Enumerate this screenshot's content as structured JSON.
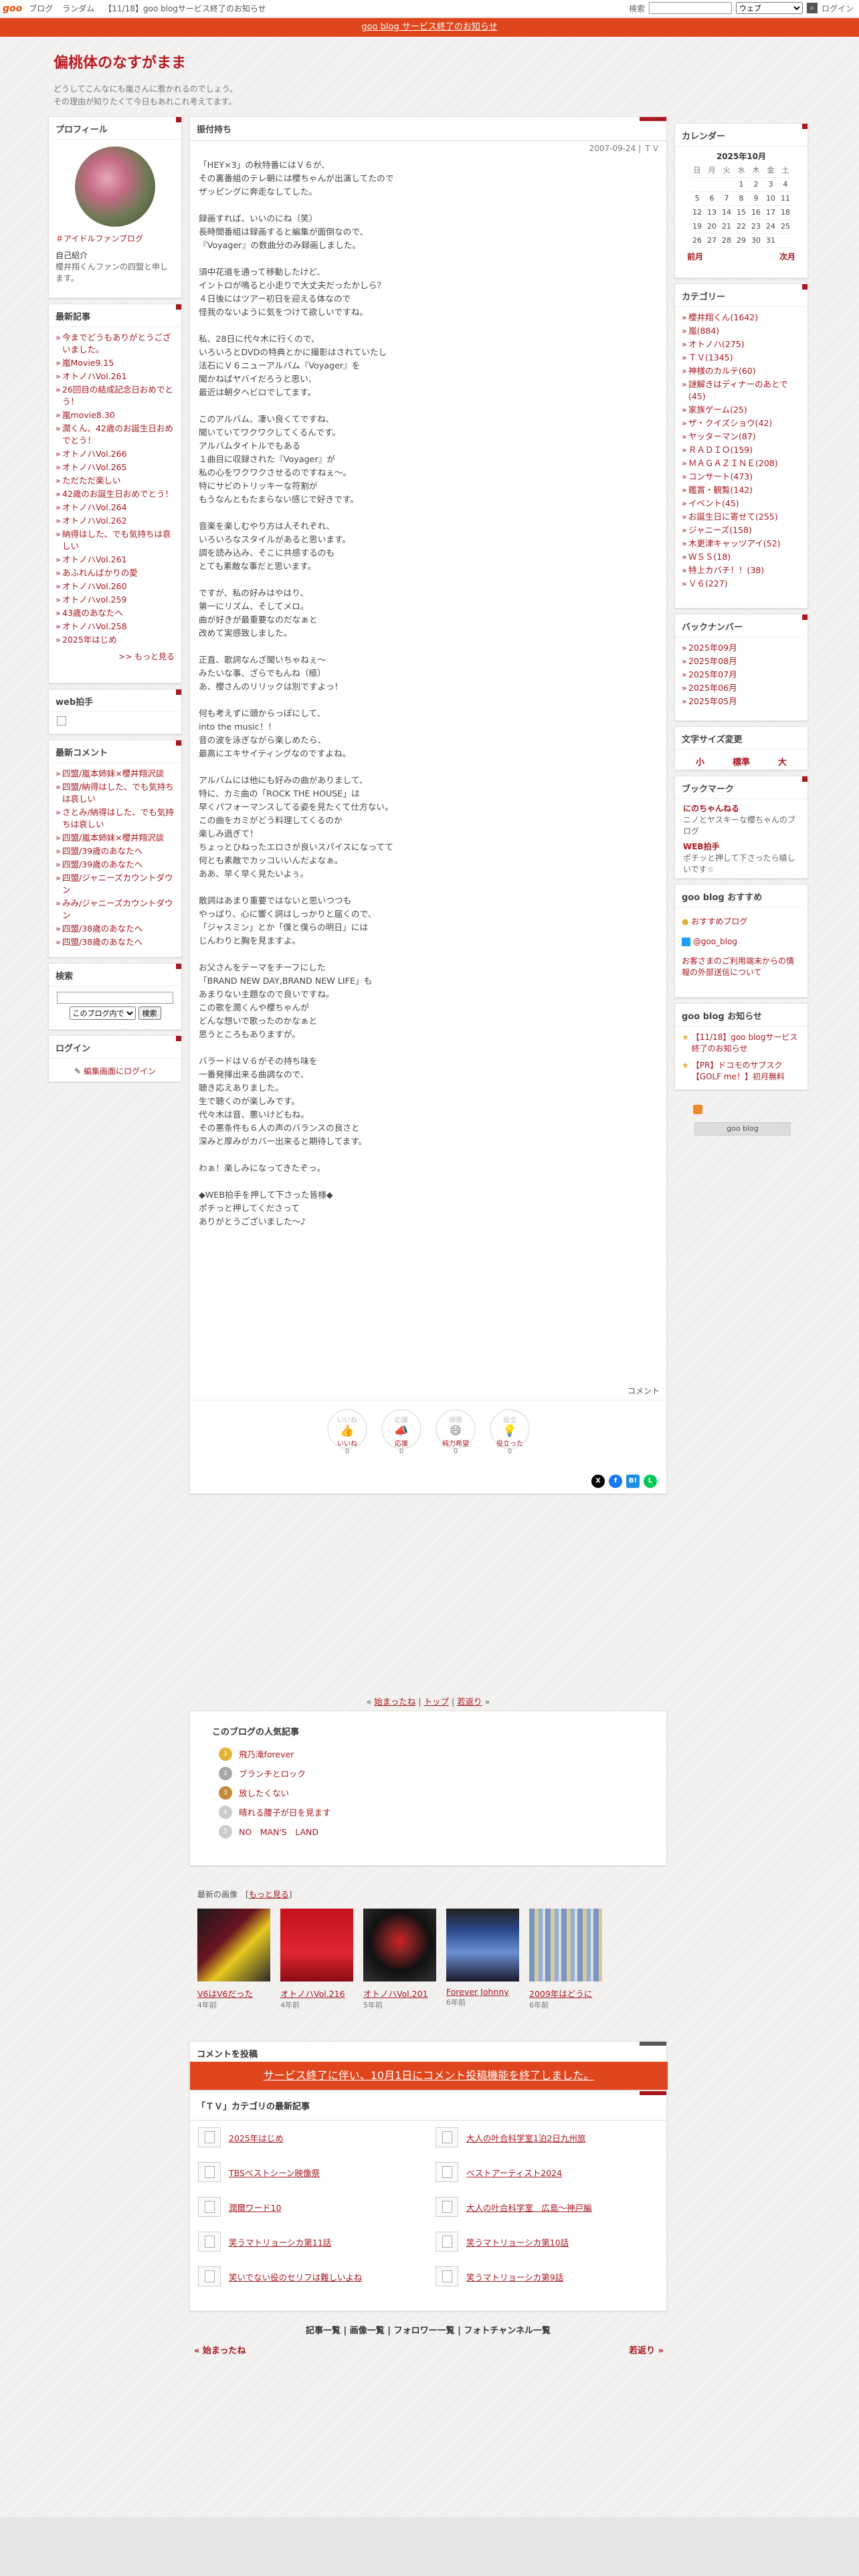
{
  "topbar": {
    "logo": "goo",
    "nav": [
      "ブログ",
      "ランダム",
      "【11/18】goo blogサービス終了のお知らせ"
    ],
    "search_label": "検索",
    "search_select": "ウェブ",
    "login": "ログイン"
  },
  "notice": "goo blog サービス終了のお知らせ",
  "blog": {
    "title": "偏桃体のなすがまま",
    "desc1": "どうしてこんなにも嵐さんに惹かれるのでしょう。",
    "desc2": "その理由が知りたくて今日もあれこれ考えてます。"
  },
  "profile": {
    "heading": "プロフィール",
    "tag": "＃アイドルファンブログ",
    "intro_label": "自己紹介",
    "intro": "櫻井翔くんファンの四盟と申します。"
  },
  "recent": {
    "heading": "最新記事",
    "items": [
      "今までどうもありがとうございました。",
      "嵐Movie9.15",
      "オトノハVol.261",
      "26回目の結成記念日おめでとう！",
      "嵐movie8.30",
      "潤くん、42歳のお誕生日おめでとう！",
      "オトノハVol.266",
      "オトノハVol.265",
      "ただただ楽しい",
      "42歳のお誕生日おめでとう！",
      "オトノハVol.264",
      "オトノハVol.262",
      "納得はした、でも気持ちは哀しい",
      "オトノハVol.261",
      "あふれんばかりの愛",
      "オトノハVol.260",
      "オトノハvol.259",
      "43歳のあなたへ",
      "オトノハVol.258",
      "2025年はじめ"
    ],
    "more": ">> もっと見る"
  },
  "webclap": {
    "heading": "web拍手"
  },
  "comments": {
    "heading": "最新コメント",
    "items": [
      "四盟/嵐本姉妹×櫻井翔沢談",
      "四盟/納得はした、でも気持ちは哀しい",
      "さとみ/納得はした、でも気持ちは哀しい",
      "四盟/嵐本姉妹×櫻井翔沢談",
      "四盟/39歳のあなたへ",
      "四盟/39歳のあなたへ",
      "四盟/ジャニーズカウントダウン",
      "みみ/ジャニーズカウントダウン",
      "四盟/38歳のあなたへ",
      "四盟/38歳のあなたへ"
    ]
  },
  "search": {
    "heading": "検索",
    "select": "このブログ内で",
    "button": "検索"
  },
  "login": {
    "heading": "ログイン",
    "link": "編集画面にログイン"
  },
  "post": {
    "title": "振付持ち",
    "date": "2007-09-24 | ＴＶ",
    "body": "「HEY×3」の秋特番にはＶ６が、\nその裏番組のテレ朝には櫻ちゃんが出演してたので\nザッピングに奔走なしてした。\n\n録画すれば、いいのにね（笑）\n長時間番組は録画すると編集が面倒なので、\n『Voyager』の数曲分のみ録画しました。\n\n須中花道を通って移動したけど、\nイントロが鳴ると小走りで大丈夫だったかしら？\n４日後にはツアー初日を迎える体なので\n怪我のないように気をつけて欲しいですね。\n\n私、28日に代々木に行くので、\nいろいろとDVDの特典とかに撮影はされていたし\n法石にＶ６ニューアルバム『Voyager』を\n聞かねばヤバイだろうと思い、\n最近は朝夕ヘビロでしてます。\n\nこのアルバム、凄い良くてですね、\n聞いていてワクワクしてくるんです。\nアルバムタイトルでもある\n１曲目に収録された『Voyager』が\n私の心をワクワクさせるのですねぇ～。\n特にサビのトリッキーな符割が\nもうなんともたまらない感じで好きです。\n\n音楽を楽しむやり方は人それぞれ、\nいろいろなスタイルがあると思います。\n調を読み込み、そこに共感するのも\nとても素敵な事だと思います。\n\nですが、私の好みはやはり、\n第一にリズム、そしてメロ。\n曲が好きが最重要なのだなぁと\n改めて実感致しました。\n\n正直、歌詞なんざ聞いちゃねぇ～\nみたいな事、ざらでもんね（極）\nあ、櫻さんのリリックは別ですよっ！\n\n何も考えずに頭からっぽにして、\ninto the music！！\n音の波を泳ぎながら楽しめたら、\n最高にエキサイティングなのですよね。\n\nアルバムには他にも好みの曲がありまして、\n特に、カミ曲の「ROCK THE HOUSE」は\n早くパフォーマンスしてる姿を見たくて仕方ない。\nこの曲をカミがどう料理してくるのか\n楽しみ過ぎて！\nちょっとひねったエロさが良いスパイスになってて\n何とも素敵でカッコいいんだよなぁ。\nああ、早く早く見たいよぅ。\n\n散詞はあまり重要ではないと思いつつも\nやっぱり、心に響く詞はしっかりと届くので、\n「ジャスミン」とか「僕と僕らの明日」には\nじんわりと胸を見ますよ。\n\nお父さんをテーマをチーフにした\n「BRAND NEW DAY,BRAND NEW LIFE」も\nあまりない主題なので良いですね。\nこの歌を潤くんや櫻ちゃんが\nどんな想いで歌ったのかなぁと\n思うところもありますが。\n\nバラードはＶ６がその持ち味を\n一番発揮出来る曲調なので、\n聴き応えありました。\n生で聴くのが楽しみです。\n代々木は音、悪いけどもね。\nその悪条件も６人の声のバランスの良さと\n深みと厚みがカバー出来ると期待してます。\n\nわぁ！楽しみになってきたぞっ。\n\n◆WEB拍手を押して下さった皆様◆\nポチっと押してくださって\nありがとうございました～♪",
    "comment_label": "コメント",
    "reactions": [
      {
        "top": "いいね",
        "label": "いいね",
        "count": "0",
        "icon": "👍"
      },
      {
        "top": "応援",
        "label": "応援",
        "count": "0",
        "icon": "📣"
      },
      {
        "top": "頑張",
        "label": "純力希望",
        "count": "0",
        "icon": "😄"
      },
      {
        "top": "役立",
        "label": "役立った",
        "count": "0",
        "icon": "💡"
      }
    ]
  },
  "pager": {
    "prev": "始まったね",
    "top": "トップ",
    "next": "若返り"
  },
  "popular": {
    "heading": "このブログの人気記事",
    "items": [
      "飛乃滝forever",
      "ブランチとロック",
      "放したくない",
      "晴れる腰子が日を見ます",
      "NO　MAN'S　LAND"
    ]
  },
  "images": {
    "heading": "最新の画像",
    "more": "もっと見る",
    "items": [
      {
        "cap": "V6はV6だった",
        "ago": "4年前"
      },
      {
        "cap": "オトノハVol.216",
        "ago": "4年前"
      },
      {
        "cap": "オトノハVol.201",
        "ago": "5年前"
      },
      {
        "cap": "Forever Johnny",
        "ago": "6年前"
      },
      {
        "cap": "2009年はどうに",
        "ago": "6年前"
      }
    ]
  },
  "comment_post": {
    "heading": "コメントを投稿",
    "banner": "サービス終了に伴い、10月1日にコメント投稿機能を終了しました。"
  },
  "tv": {
    "heading": "「ＴＶ」カテゴリの最新記事",
    "items": [
      "2025年はじめ",
      "大人の叶合科学室1泊2日九州旅",
      "TBSベストシーン映像祭",
      "ベストアーティスト2024",
      "潤爾ワード10",
      "大人の叶合科学室　広島〜神戸編",
      "笑うマトリョーシカ第11話",
      "笑うマトリョーシカ第10話",
      "笑いでない役のセリフは難しいよね",
      "笑うマトリョーシカ第9話"
    ]
  },
  "footlinks": [
    "記事一覧",
    "画像一覧",
    "フォロワー一覧",
    "フォトチャンネル一覧"
  ],
  "footnav": {
    "prev": "« 始まったね",
    "next": "若返り »"
  },
  "calendar": {
    "heading": "カレンダー",
    "month": "2025年10月",
    "week": [
      "日",
      "月",
      "火",
      "水",
      "木",
      "金",
      "土"
    ],
    "rows": [
      [
        "",
        "",
        "",
        "1",
        "2",
        "3",
        "4"
      ],
      [
        "5",
        "6",
        "7",
        "8",
        "9",
        "10",
        "11"
      ],
      [
        "12",
        "13",
        "14",
        "15",
        "16",
        "17",
        "18"
      ],
      [
        "19",
        "20",
        "21",
        "22",
        "23",
        "24",
        "25"
      ],
      [
        "26",
        "27",
        "28",
        "29",
        "30",
        "31",
        ""
      ]
    ],
    "prev": "前月",
    "next": "次月"
  },
  "categories": {
    "heading": "カテゴリー",
    "items": [
      "櫻井翔くん(1642)",
      "嵐(884)",
      "オトノハ(275)",
      "ＴＶ(1345)",
      "神様のカルテ(60)",
      "謎解きはディナーのあとで(45)",
      "家族ゲーム(25)",
      "ザ・クイズショウ(42)",
      "ヤッターマン(87)",
      "ＲＡＤＩＯ(159)",
      "ＭＡＧＡＺＩＮＥ(208)",
      "コンサート(473)",
      "鑑賞・観覧(142)",
      "イベント(45)",
      "お誕生日に寄せて(255)",
      "ジャニーズ(158)",
      "木更津キャッツアイ(52)",
      "ＷＳＳ(18)",
      "特上カバチ！！(38)",
      "Ｖ６(227)"
    ]
  },
  "backnumber": {
    "heading": "バックナンバー",
    "items": [
      "2025年09月",
      "2025年08月",
      "2025年07月",
      "2025年06月",
      "2025年05月"
    ]
  },
  "fontsize": {
    "heading": "文字サイズ変更",
    "small": "小",
    "normal": "標準",
    "large": "大"
  },
  "bookmark": {
    "heading": "ブックマーク",
    "name1": "にのちゃんねる",
    "desc1": "ニノとヤスキーな櫻ちゃんのブログ",
    "name2": "WEB拍手",
    "desc2": "ポチッと押して下さったら嬉しいです☆"
  },
  "recommend": {
    "heading": "goo blog おすすめ",
    "link1": "おすすめブログ",
    "link2": "@goo_blog",
    "note": "お客さまのご利用端末からの情報の外部送信について"
  },
  "info": {
    "heading": "goo blog お知らせ",
    "link1": "【11/18】goo blogサービス終了のお知らせ",
    "link2": "【PR】ドコモのサブスク【GOLF me！】初月無料"
  },
  "badge": "goo blog"
}
